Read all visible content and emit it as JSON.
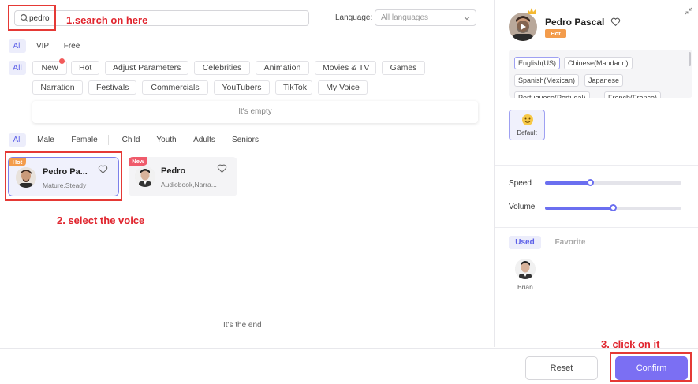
{
  "search": {
    "value": "pedro",
    "placeholder": ""
  },
  "language": {
    "label": "Language:",
    "selected": "All languages"
  },
  "tabs": [
    "All",
    "VIP",
    "Free"
  ],
  "categories_row1": [
    "All",
    "New",
    "Hot",
    "Adjust Parameters",
    "Celebrities",
    "Animation",
    "Movies & TV",
    "Games"
  ],
  "categories_row2": [
    "Narration",
    "Festivals",
    "Commercials",
    "YouTubers",
    "TikTok",
    "My Voice"
  ],
  "empty_text": "It's empty",
  "filters": [
    "All",
    "Male",
    "Female",
    "Child",
    "Youth",
    "Adults",
    "Seniors"
  ],
  "voices": [
    {
      "name": "Pedro Pa...",
      "desc": "Mature,Steady",
      "badge": "Hot"
    },
    {
      "name": "Pedro",
      "desc": "Audiobook,Narra...",
      "badge": "New"
    }
  ],
  "end_text": "It's the end",
  "annotations": {
    "step1": "1.search on here",
    "step2": "2. select the voice",
    "step3": "3. click on it"
  },
  "right_panel": {
    "name": "Pedro Pascal",
    "badge": "Hot",
    "languages": [
      "English(US)",
      "Chinese(Mandarin)",
      "Spanish(Mexican)",
      "Japanese",
      "Portuguese(Portugal)",
      "French(France)"
    ],
    "default_label": "Default",
    "speed_label": "Speed",
    "speed_value": 0.33,
    "volume_label": "Volume",
    "volume_value": 0.5,
    "used_label": "Used",
    "favorite_label": "Favorite",
    "used_voice": "Brian"
  },
  "buttons": {
    "reset": "Reset",
    "confirm": "Confirm"
  },
  "colors": {
    "accent": "#6b6ff0",
    "confirm": "#7b6ff3",
    "annotation": "#e0242d",
    "hot": "#f39c4c",
    "new": "#ef5b6b"
  }
}
